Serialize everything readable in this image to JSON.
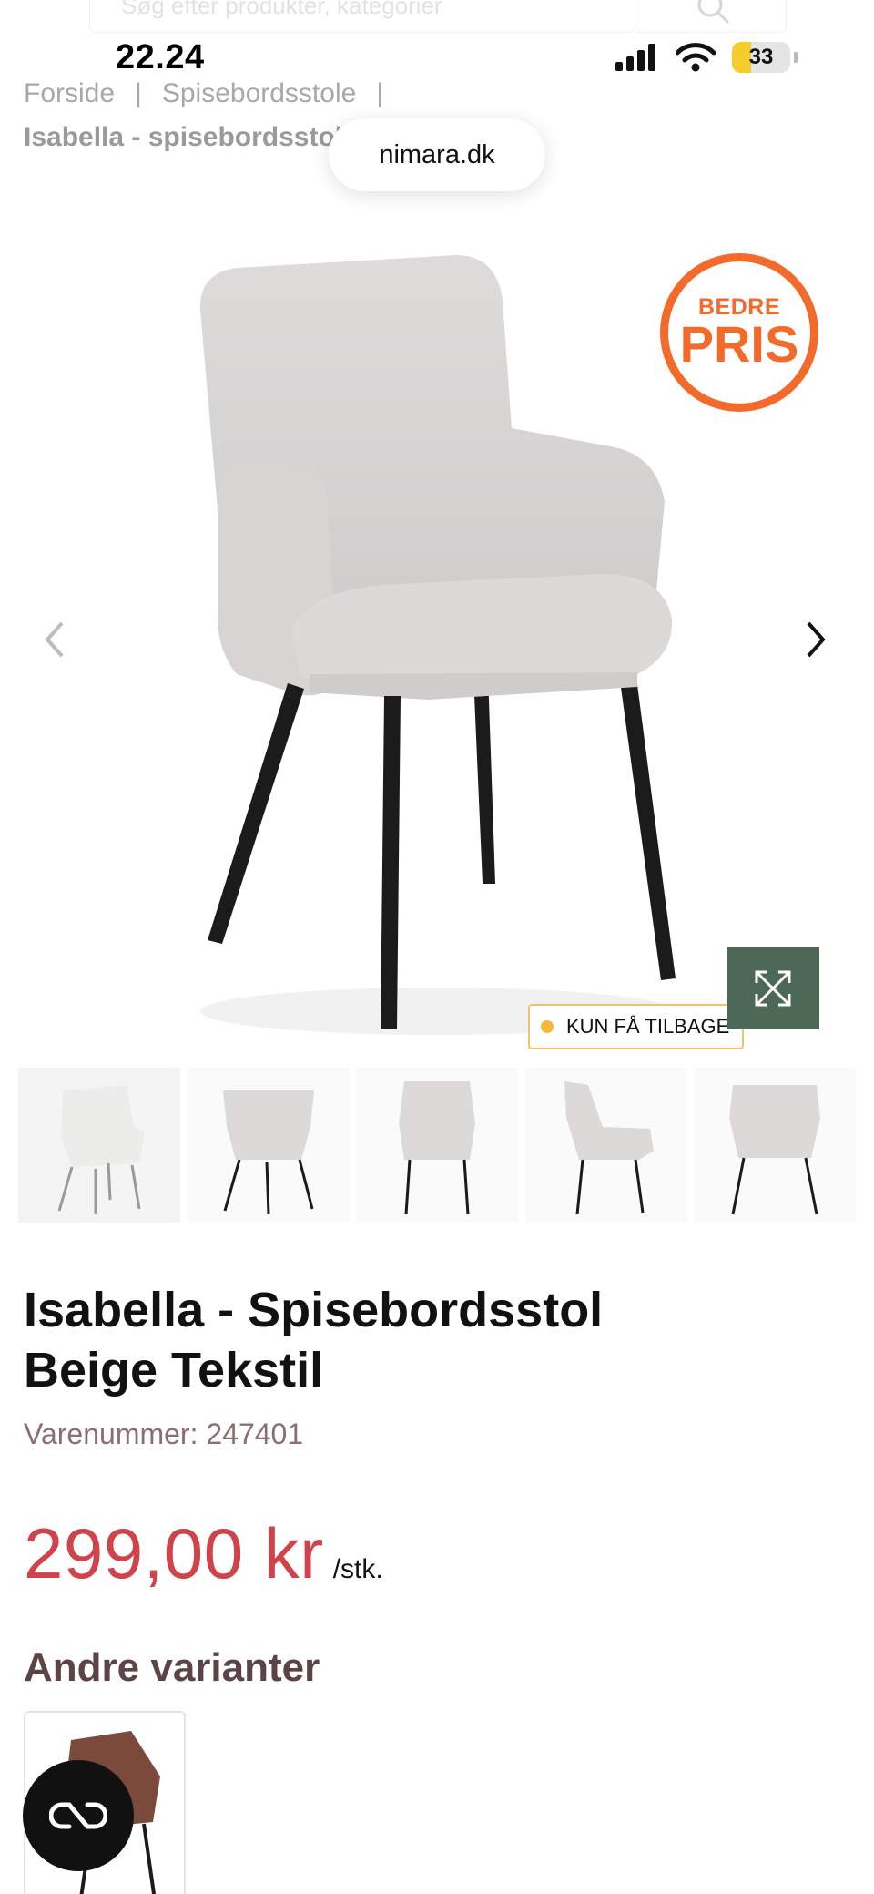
{
  "status_bar": {
    "time": "22.24",
    "battery": "33",
    "battery_level": 0.33
  },
  "search": {
    "placeholder": "Søg efter produkter, kategorier",
    "button_icon": "search-icon"
  },
  "breadcrumb": {
    "home": "Forside",
    "separator": "|",
    "category": "Spisebordsstole",
    "current": "Isabella - spisebordsstol beige tekstil"
  },
  "browser": {
    "url": "nimara.dk"
  },
  "gallery": {
    "promo_badge": {
      "line1": "BEDRE",
      "line2": "PRIS",
      "color": "#f36a2a"
    },
    "stock_label": "KUN FÅ TILBAGE",
    "thumbnail_count": 5
  },
  "product": {
    "title_line1": "Isabella - Spisebordsstol",
    "title_line2": "Beige Tekstil",
    "sku": "Varenummer: 247401",
    "price": "299,00 kr",
    "unit": "/stk.",
    "price_color": "#d0434a"
  },
  "variants": {
    "title": "Andre varianter"
  },
  "colors": {
    "accent_green": "#4d6857",
    "heading_brown": "#5c4346"
  }
}
